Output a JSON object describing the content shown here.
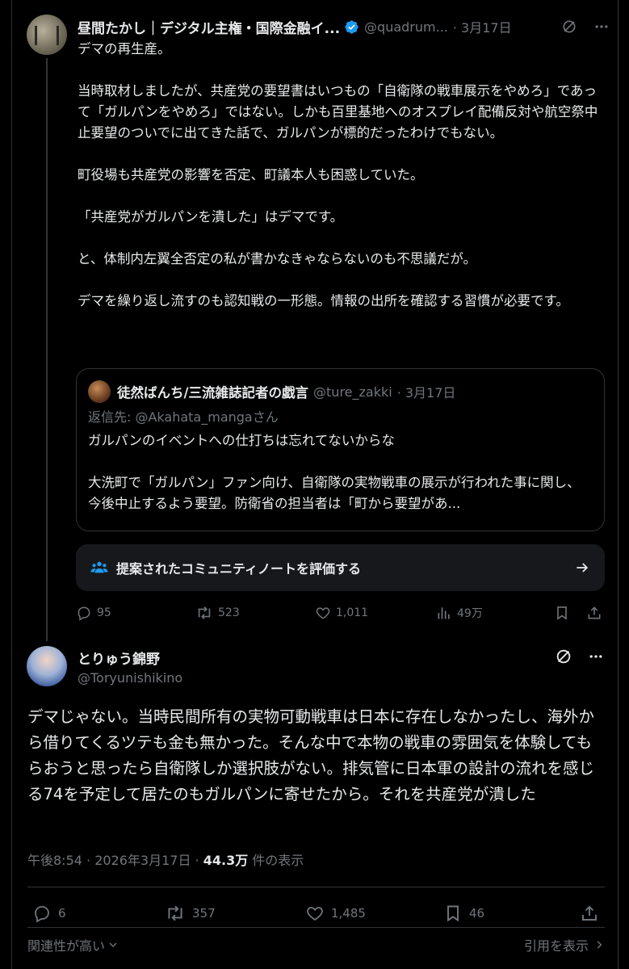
{
  "post1": {
    "display_name": "昼間たかし｜デジタル主権・国際金融イ...",
    "handle": "@quadrum...",
    "date": "· 3月17日",
    "paragraphs": [
      "デマの再生産。",
      "当時取材しましたが、共産党の要望書はいつもの「自衛隊の戦車展示をやめろ」であって「ガルパンをやめろ」ではない。しかも百里基地へのオスプレイ配備反対や航空祭中止要望のついでに出てきた話で、ガルパンが標的だったわけでもない。",
      "町役場も共産党の影響を否定、町議本人も困惑していた。",
      "「共産党がガルパンを潰した」はデマです。",
      "と、体制内左翼全否定の私が書かなきゃならないのも不思議だが。",
      "デマを繰り返し流すのも認知戦の一形態。情報の出所を確認する習慣が必要です。"
    ],
    "quote": {
      "display_name": "徒然ばんち/三流雑誌記者の戯言",
      "handle": "@ture_zakki",
      "date": "· 3月17日",
      "reply_to": "返信先: @Akahata_mangaさん",
      "line1": "ガルパンのイベントへの仕打ちは忘れてないからな",
      "line2": "大洗町で「ガルパン」ファン向け、自衛隊の実物戦車の展示が行われた事に関し、今後中止するよう要望。防衛省の担当者は「町から要望があ..."
    },
    "community_note_label": "提案されたコミュニティノートを評価する",
    "replies": "95",
    "reposts": "523",
    "likes": "1,011",
    "views": "49万"
  },
  "post2": {
    "display_name": "とりゅう錦野",
    "handle": "@Toryunishikino",
    "text": "デマじゃない。当時民間所有の実物可動戦車は日本に存在しなかったし、海外から借りてくるツテも金も無かった。そんな中で本物の戦車の雰囲気を体験してもらおうと思ったら自衛隊しか選択肢がない。排気管に日本軍の設計の流れを感じる74を予定して居たのもガルパンに寄せたから。それを共産党が潰した",
    "timestamp": "午後8:54 · 2026年3月17日 · ",
    "views_count": "44.3万",
    "views_label": " 件の表示",
    "replies": "6",
    "reposts": "357",
    "likes": "1,485",
    "bookmarks": "46"
  },
  "footer": {
    "sort_label": "関連性が高い",
    "quotes_link": "引用を表示"
  },
  "colors": {
    "background": "#000000",
    "text": "#e7e9ea",
    "muted": "#71767b",
    "verified": "#1d9bf0",
    "border": "#2f3336"
  }
}
